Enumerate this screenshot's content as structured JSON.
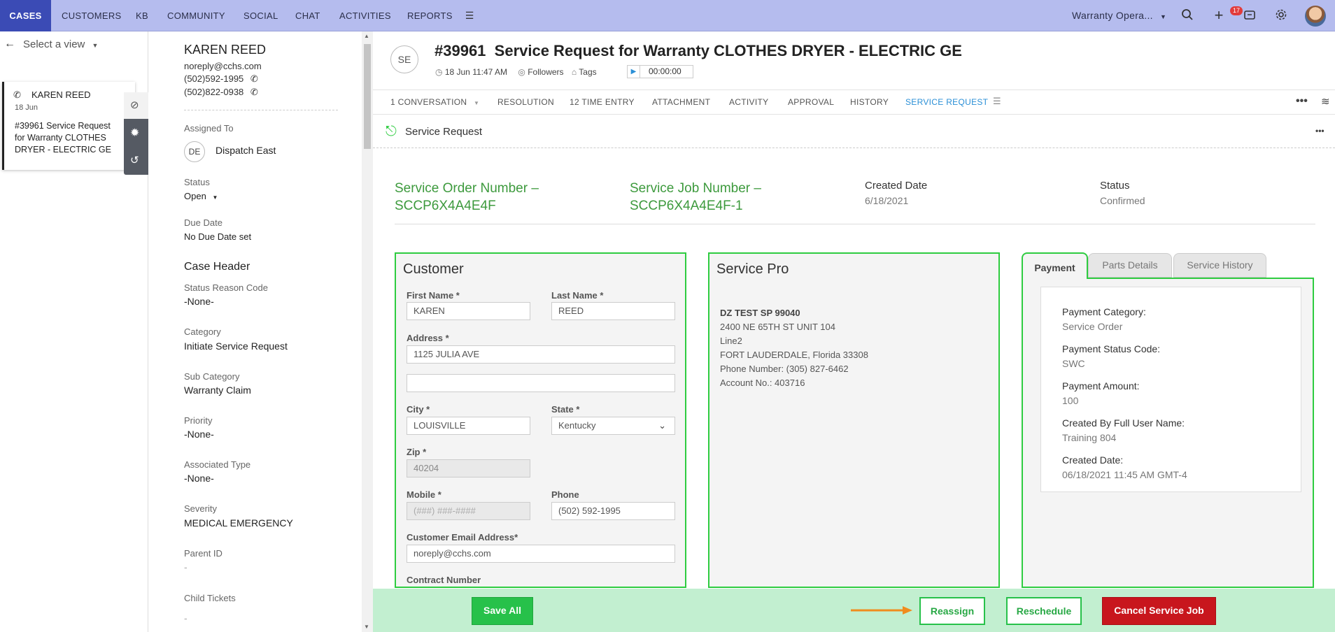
{
  "topnav": {
    "tabs": [
      "CASES",
      "CUSTOMERS",
      "KB",
      "COMMUNITY",
      "SOCIAL",
      "CHAT",
      "ACTIVITIES",
      "REPORTS"
    ],
    "workspace": "Warranty Opera...",
    "notification_count": "17"
  },
  "leftpanel": {
    "view_select": "Select a view",
    "card": {
      "name": "KAREN REED",
      "date": "18 Jun",
      "line1": "#39961   Service Request",
      "line2": "for Warranty CLOTHES",
      "line3": "DRYER - ELECTRIC GE"
    }
  },
  "details": {
    "contact_name": "KAREN REED",
    "email": "noreply@cchs.com",
    "phone1": "(502)592-1995",
    "phone2": "(502)822-0938",
    "assigned_to_label": "Assigned To",
    "assigned_initials": "DE",
    "assigned_to": "Dispatch East",
    "status_label": "Status",
    "status": "Open",
    "due_date_label": "Due Date",
    "due_date": "No Due Date set",
    "section": "Case Header",
    "status_reason_label": "Status Reason Code",
    "status_reason": "-None-",
    "category_label": "Category",
    "category": "Initiate Service Request",
    "subcategory_label": "Sub Category",
    "subcategory": "Warranty Claim",
    "priority_label": "Priority",
    "priority": "-None-",
    "assoc_type_label": "Associated Type",
    "assoc_type": "-None-",
    "severity_label": "Severity",
    "severity": "MEDICAL EMERGENCY",
    "parent_label": "Parent ID",
    "parent": "-",
    "child_label": "Child Tickets",
    "child": "-"
  },
  "header": {
    "avatar_initials": "SE",
    "case_number": "#39961",
    "title": "Service Request for Warranty CLOTHES DRYER - ELECTRIC GE",
    "date": "18 Jun 11:47 AM",
    "followers": "Followers",
    "tags": "Tags",
    "timer": "00:00:00"
  },
  "tabs": [
    "1  CONVERSATION",
    "RESOLUTION",
    "12  TIME ENTRY",
    "ATTACHMENT",
    "ACTIVITY",
    "APPROVAL",
    "HISTORY",
    "SERVICE REQUEST"
  ],
  "active_tab": "SERVICE REQUEST",
  "service_request": {
    "heading": "Service Request",
    "order_number_line1": "Service Order Number –",
    "order_number_line2": "SCCP6X4A4E4F",
    "job_number_line1": "Service Job Number –",
    "job_number_line2": "SCCP6X4A4E4F-1",
    "created_date_label": "Created Date",
    "created_date": "6/18/2021",
    "status_label": "Status",
    "status": "Confirmed"
  },
  "customer": {
    "heading": "Customer",
    "first_name_label": "First Name *",
    "first_name": "KAREN",
    "last_name_label": "Last Name *",
    "last_name": "REED",
    "address_label": "Address *",
    "address": "1125 JULIA AVE",
    "address2": "",
    "city_label": "City *",
    "city": "LOUISVILLE",
    "state_label": "State *",
    "state": "Kentucky",
    "zip_label": "Zip *",
    "zip": "40204",
    "mobile_label": "Mobile *",
    "mobile_placeholder": "(###) ###-####",
    "phone_label": "Phone",
    "phone": "(502) 592-1995",
    "email_label": "Customer Email Address*",
    "email": "noreply@cchs.com",
    "contract_label": "Contract Number"
  },
  "service_pro": {
    "heading": "Service Pro",
    "name": "DZ TEST SP 99040",
    "line1": "2400 NE 65TH ST UNIT 104",
    "line2": "Line2",
    "line3": "FORT LAUDERDALE, Florida 33308",
    "phone": "Phone Number: (305) 827-6462",
    "account": "Account No.: 403716"
  },
  "payment": {
    "tabs": [
      "Payment",
      "Parts Details",
      "Service History"
    ],
    "category_label": "Payment Category:",
    "category": "Service Order",
    "status_label": "Payment Status Code:",
    "status": "SWC",
    "amount_label": "Payment Amount:",
    "amount": "100",
    "created_by_label": "Created By Full User Name:",
    "created_by": "Training 804",
    "created_date_label": "Created Date:",
    "created_date": "06/18/2021 11:45 AM GMT-4"
  },
  "actions": {
    "save_all": "Save All",
    "reassign": "Reassign",
    "reschedule": "Reschedule",
    "cancel": "Cancel Service Job"
  },
  "colors": {
    "nav_bg": "#b5bcee",
    "nav_active": "#3b4bb5",
    "accent_blue": "#2a8fd6",
    "green": "#2ecc40",
    "green_text": "#3d9a3d",
    "danger": "#c8161d",
    "arrow": "#f08c1e"
  }
}
